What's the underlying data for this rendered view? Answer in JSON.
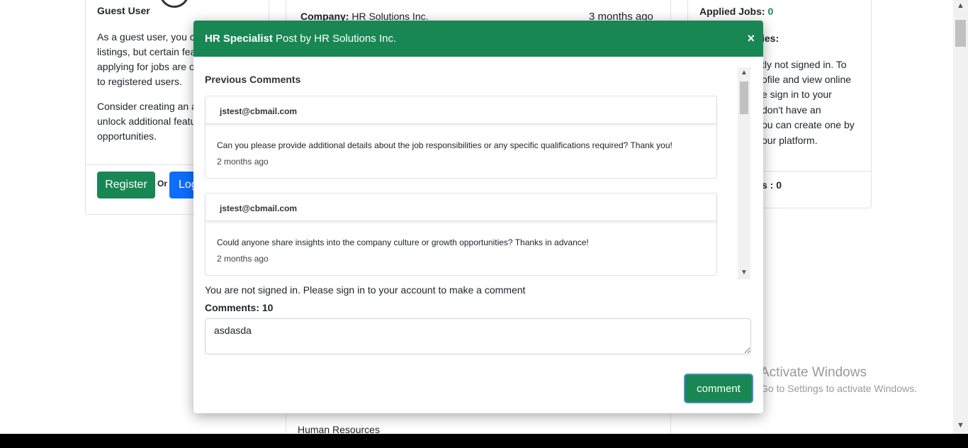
{
  "left_card": {
    "title": "Guest User",
    "para1_lines": [
      "As a guest user, you ca",
      "listings, but certain fea",
      "applying for jobs are o",
      "to registered users."
    ],
    "para2_lines": [
      "Consider creating an a",
      "unlock additional featu",
      "opportunities."
    ],
    "register_label": "Register",
    "or_label": "Or",
    "login_label": "Log"
  },
  "mid_card": {
    "company_label": "Company:",
    "company_value": "HR Solutions Inc.",
    "time_ago": "3 months ago",
    "department": "Human Resources"
  },
  "right_card": {
    "applied_label": "Applied Jobs:",
    "applied_value": "0",
    "subheading": "ies:",
    "para_lines": [
      "tly not signed in. To",
      "ofile and view online",
      "e sign in to your",
      "don't have an",
      "ou can create one by",
      "our platform."
    ],
    "count_label": "s : 0"
  },
  "modal": {
    "title_bold": "HR Specialist",
    "title_rest": "Post by HR Solutions Inc.",
    "close_label": "×",
    "previous_comments": "Previous Comments",
    "comments": [
      {
        "email": "jstest@cbmail.com",
        "text": "Can you please provide additional details about the job responsibilities or any specific qualifications required? Thank you!",
        "time": "2 months ago"
      },
      {
        "email": "jstest@cbmail.com",
        "text": "Could anyone share insights into the company culture or growth opportunities? Thanks in advance!",
        "time": "2 months ago"
      }
    ],
    "signin_notice": "You are not signed in. Please sign in to your account to make a comment",
    "comments_count": "Comments: 10",
    "textarea_value": "asdasda",
    "comment_button": "comment"
  },
  "watermark": {
    "line1": "Activate Windows",
    "line2": "Go to Settings to activate Windows."
  },
  "colors": {
    "primary_green": "#198754",
    "primary_blue": "#0d6efd"
  }
}
